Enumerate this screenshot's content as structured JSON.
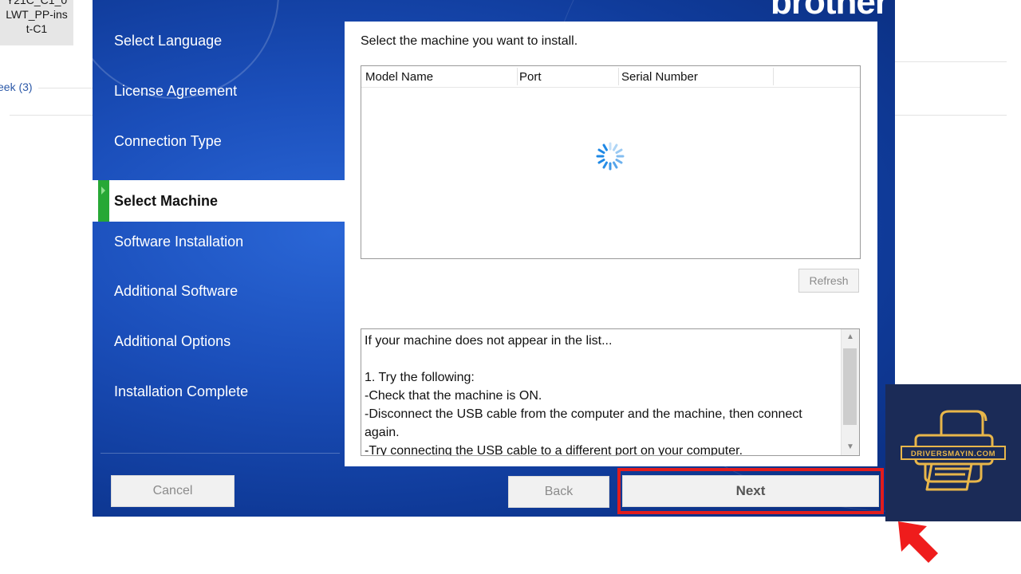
{
  "desktop": {
    "file_label_lines": [
      "Y21C_C1_0",
      "LWT_PP-ins",
      "t-C1"
    ],
    "link_text_1": "eek (3)",
    "link_text_2": ")"
  },
  "installer": {
    "brand": "brother",
    "steps": [
      {
        "label": "Select Language",
        "active": false
      },
      {
        "label": "License Agreement",
        "active": false
      },
      {
        "label": "Connection Type",
        "active": false
      },
      {
        "label": "Select Machine",
        "active": true
      },
      {
        "label": "Software Installation",
        "active": false
      },
      {
        "label": "Additional Software",
        "active": false
      },
      {
        "label": "Additional Options",
        "active": false
      },
      {
        "label": "Installation Complete",
        "active": false
      }
    ],
    "prompt": "Select the machine you want to install.",
    "list_columns": [
      "Model Name",
      "Port",
      "Serial Number"
    ],
    "refresh_label": "Refresh",
    "help_lines": [
      "If your machine does not appear in the list...",
      "",
      "1. Try the following:",
      "-Check that the machine is ON.",
      "-Disconnect the USB cable from the computer and the machine, then connect",
      "again.",
      "-Try connecting the USB cable to a different port on your computer."
    ],
    "buttons": {
      "cancel": "Cancel",
      "back": "Back",
      "next": "Next"
    }
  },
  "watermark": {
    "text": "DRIVERSMAYIN.COM"
  },
  "colors": {
    "window_blue": "#1b4fbb",
    "active_marker": "#27a836",
    "highlight_red": "#e11d1d",
    "watermark_bg": "#1b2b57",
    "watermark_gold": "#e8b64a"
  }
}
